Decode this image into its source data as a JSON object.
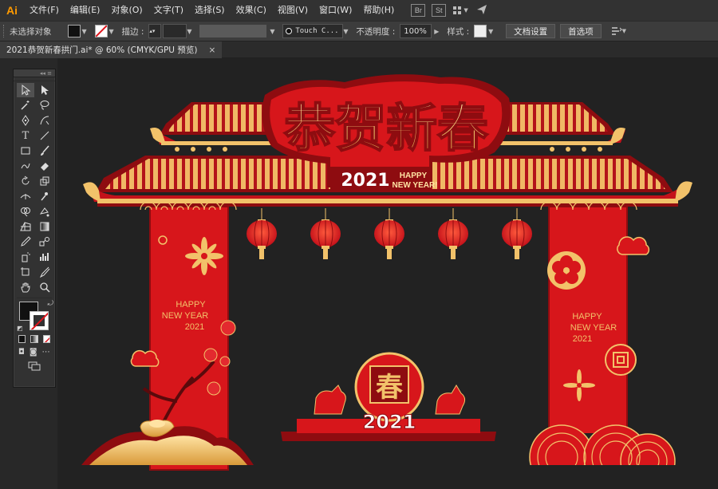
{
  "app": {
    "logo": "Ai"
  },
  "menu": [
    "文件(F)",
    "编辑(E)",
    "对象(O)",
    "文字(T)",
    "选择(S)",
    "效果(C)",
    "视图(V)",
    "窗口(W)",
    "帮助(H)"
  ],
  "menubar_icons": {
    "bridge": "Br",
    "stock": "St",
    "layout": "layout-icon",
    "send": "paper-plane-icon"
  },
  "controlbar": {
    "selection_label": "未选择对象",
    "stroke_label": "描边 :",
    "brush_label": "Touch C...",
    "opacity_label": "不透明度 :",
    "opacity_value": "100%",
    "style_label": "样式 :",
    "doc_settings": "文档设置",
    "preferences": "首选项"
  },
  "document_tab": {
    "title": "2021恭贺新春拱门.ai* @ 60% (CMYK/GPU 预览)",
    "close": "×"
  },
  "artwork": {
    "headline": "恭贺新春",
    "year": "2021",
    "greeting_line1": "HAPPY",
    "greeting_line2": "NEW YEAR!",
    "left_pillar": [
      "HAPPY",
      "NEW YEAR",
      "2021"
    ],
    "right_pillar": [
      "HAPPY",
      "NEW YEAR",
      "2021"
    ],
    "center_char": "春",
    "stage_year": "2021",
    "colors": {
      "red": "#d7161b",
      "dark_red": "#8e0c10",
      "gold": "#f2c26a",
      "gold_dark": "#c98a2e",
      "canvas": "#222222"
    }
  }
}
